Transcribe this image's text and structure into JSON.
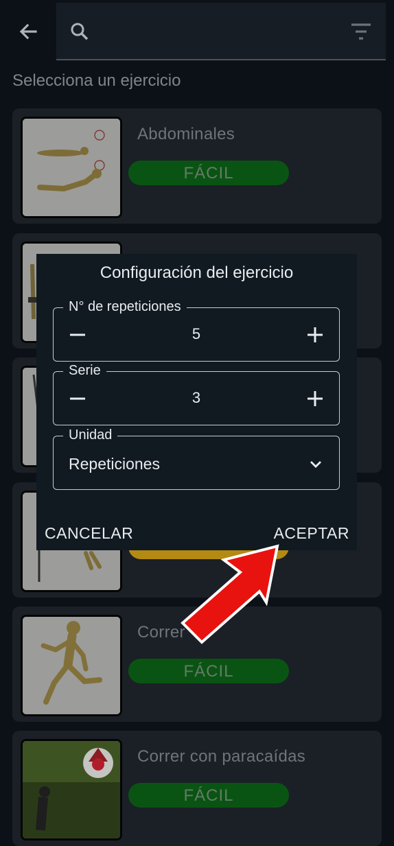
{
  "section_title": "Selecciona un ejercicio",
  "exercises": [
    {
      "name": "Abdominales",
      "difficulty": "FÁCIL"
    },
    {
      "name": "",
      "difficulty": ""
    },
    {
      "name": "",
      "difficulty": ""
    },
    {
      "name": "",
      "difficulty": ""
    },
    {
      "name": "Correr",
      "difficulty": "FÁCIL"
    },
    {
      "name": "Correr con paracaídas",
      "difficulty": "FÁCIL"
    }
  ],
  "dialog": {
    "title": "Configuración del ejercicio",
    "repetitions": {
      "label": "N° de repeticiones",
      "value": "5"
    },
    "series": {
      "label": "Serie",
      "value": "3"
    },
    "unit": {
      "label": "Unidad",
      "value": "Repeticiones"
    },
    "cancel_label": "CANCELAR",
    "accept_label": "ACEPTAR"
  },
  "colors": {
    "background": "#0c1117",
    "card": "#1b2026",
    "dialog": "#111921",
    "easy_badge": "#0a5413",
    "medium_badge": "#b38a12",
    "arrow": "#e8130f"
  },
  "icons": {
    "back": "arrow-back-icon",
    "search": "search-icon",
    "filter": "filter-icon",
    "minus": "minus-icon",
    "plus": "plus-icon",
    "dropdown": "chevron-down-icon"
  }
}
